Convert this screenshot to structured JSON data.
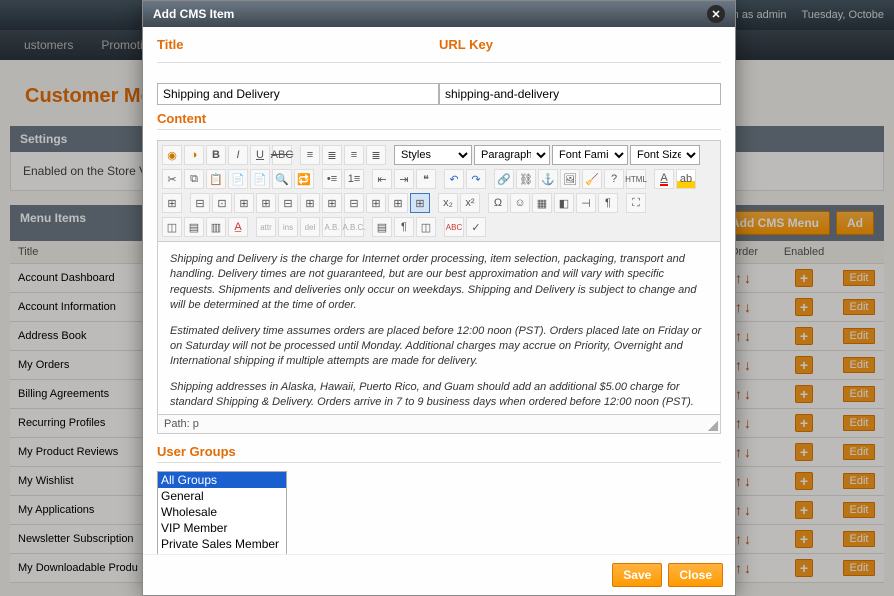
{
  "topbar": {
    "logged_in": "ed in as admin",
    "date": "Tuesday, Octobe"
  },
  "menubar": {
    "item1": "ustomers",
    "item2": "Promotions"
  },
  "page": {
    "title": "Customer Menu Bu",
    "settings_label": "Settings",
    "settings_text": "Enabled on the Store Vie",
    "menu_items_label": "Menu Items",
    "add_cms_menu": "Add CMS Menu",
    "add_truncated": "Ad"
  },
  "grid": {
    "th_title": "Title",
    "th_order": "Order",
    "th_enabled": "Enabled",
    "edit": "Edit",
    "rows": [
      {
        "title": "Account Dashboard"
      },
      {
        "title": "Account Information"
      },
      {
        "title": "Address Book"
      },
      {
        "title": "My Orders"
      },
      {
        "title": "Billing Agreements"
      },
      {
        "title": "Recurring Profiles"
      },
      {
        "title": "My Product Reviews"
      },
      {
        "title": "My Wishlist"
      },
      {
        "title": "My Applications"
      },
      {
        "title": "Newsletter Subscription"
      },
      {
        "title": "My Downloadable Produ"
      }
    ]
  },
  "modal": {
    "header": "Add CMS Item",
    "title_label": "Title",
    "urlkey_label": "URL Key",
    "title_value": "Shipping and Delivery",
    "urlkey_value": "shipping-and-delivery",
    "content_label": "Content",
    "para1": "Shipping and Delivery is the charge for Internet order processing, item selection, packaging, transport and handling. Delivery times are not guaranteed, but are our best approximation and will vary with specific requests. Shipments and deliveries only occur on weekdays. Shipping and Delivery is subject to change and will be determined at the time of order.",
    "para2": "Estimated delivery time assumes orders are placed before 12:00 noon (PST). Orders placed late on Friday or on Saturday will not be processed until Monday. Additional charges may accrue on Priority, Overnight and International shipping if multiple attempts are made for delivery.",
    "para3": "Shipping addresses in Alaska, Hawaii, Puerto Rico, and Guam should add an additional $5.00 charge for standard Shipping & Delivery. Orders arrive in 7 to 9 business days when ordered before 12:00 noon (PST).",
    "path": "Path: p",
    "user_groups_label": "User Groups",
    "groups": [
      "All Groups",
      "General",
      "Wholesale",
      "VIP Member",
      "Private Sales Member"
    ],
    "styles_sel": "Styles",
    "para_sel": "Paragraph",
    "font_family_sel": "Font Family",
    "font_size_sel": "Font Size",
    "save": "Save",
    "close": "Close"
  }
}
